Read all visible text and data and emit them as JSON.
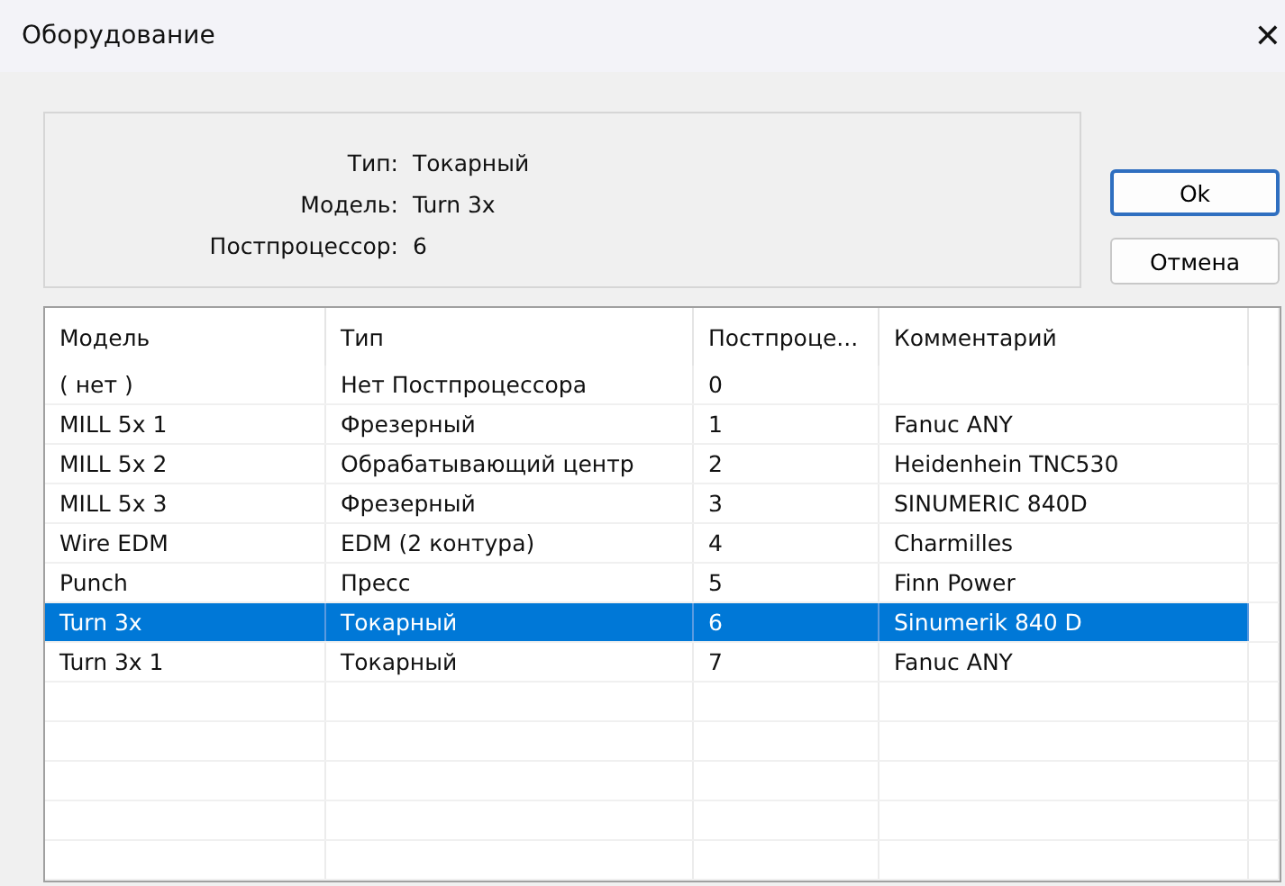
{
  "window": {
    "title": "Оборудование",
    "close": "✕"
  },
  "info": [
    {
      "label": "Тип:",
      "value": "Токарный"
    },
    {
      "label": "Модель:",
      "value": "Turn 3x"
    },
    {
      "label": "Постпроцессор:",
      "value": "6"
    }
  ],
  "buttons": [
    {
      "label": "Ok",
      "default": true
    },
    {
      "label": "Отмена",
      "default": false
    }
  ],
  "table": {
    "columns": [
      "Модель",
      "Тип",
      "Постпроце...",
      "Комментарий"
    ],
    "rows": [
      {
        "cells": [
          "( нет )",
          "Нет Постпроцессора",
          "0",
          ""
        ],
        "selected": false
      },
      {
        "cells": [
          "MILL 5x 1",
          "Фрезерный",
          "1",
          "Fanuc ANY"
        ],
        "selected": false
      },
      {
        "cells": [
          "MILL 5x 2",
          "Обрабатывающий центр",
          "2",
          "Heidenhein TNC530"
        ],
        "selected": false
      },
      {
        "cells": [
          "MILL 5x 3",
          "Фрезерный",
          "3",
          "SINUMERIC 840D"
        ],
        "selected": false
      },
      {
        "cells": [
          "Wire EDM",
          "EDM (2 контура)",
          "4",
          "Charmilles"
        ],
        "selected": false
      },
      {
        "cells": [
          "Punch",
          "Пресс",
          "5",
          "Finn Power"
        ],
        "selected": false
      },
      {
        "cells": [
          "Turn 3x",
          "Токарный",
          "6",
          "Sinumerik 840 D"
        ],
        "selected": true
      },
      {
        "cells": [
          "Turn 3x 1",
          "Токарный",
          "7",
          "Fanuc ANY"
        ],
        "selected": false
      }
    ]
  }
}
